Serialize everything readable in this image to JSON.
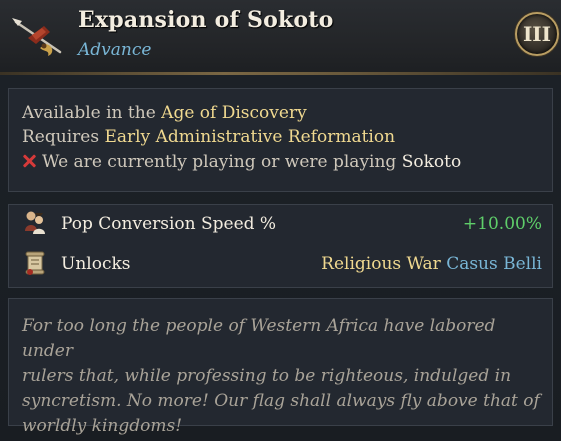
{
  "header": {
    "title": "Expansion of Sokoto",
    "subtitle": "Advance",
    "tier": "III",
    "icon": "spear-advance-icon"
  },
  "requirements": {
    "available_prefix": "Available in the",
    "available_value": "Age of Discovery",
    "requires_prefix": "Requires",
    "requires_value": "Early Administrative Reformation",
    "condition_text": "We are currently playing or were playing",
    "condition_value": "Sokoto",
    "condition_status": "not-met"
  },
  "effects": [
    {
      "icon": "population-icon",
      "label": "Pop Conversion Speed %",
      "value": "+10.00%",
      "value_color": "#5fcf6a"
    },
    {
      "icon": "scroll-icon",
      "label": "Unlocks",
      "value_primary": "Religious War",
      "value_secondary": "Casus Belli"
    }
  ],
  "flavor": {
    "lines": [
      "For too long the people of Western Africa have labored under",
      "rulers that, while professing to be righteous, indulged in",
      "syncretism. No more! Our flag shall always fly above that of",
      "worldly kingdoms!"
    ]
  },
  "colors": {
    "title": "#f3ede0",
    "subtitle": "#79b6d6",
    "highlight": "#f0d990",
    "positive": "#5fcf6a",
    "link": "#79b6d6",
    "negative": "#d63a3a"
  }
}
